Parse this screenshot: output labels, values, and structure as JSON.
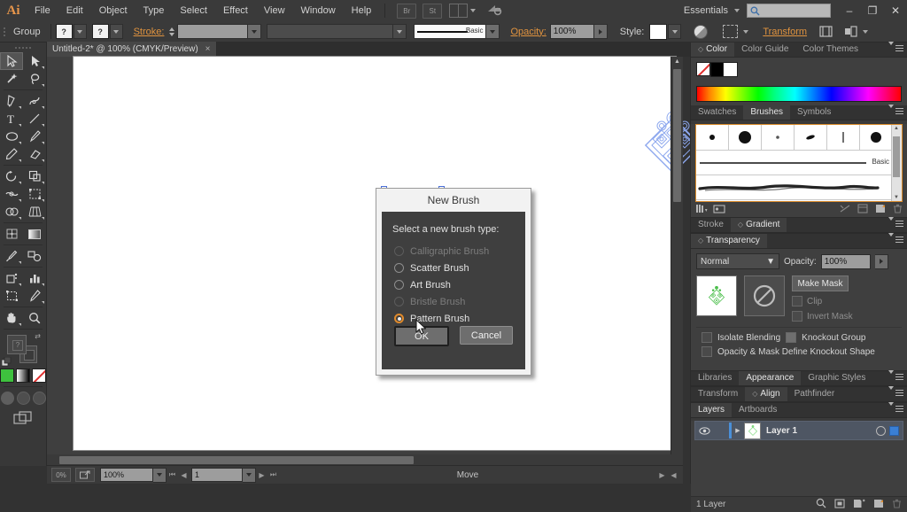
{
  "app": {
    "name": "Adobe Illustrator",
    "logo_text": "Ai"
  },
  "menubar": {
    "items": [
      "File",
      "Edit",
      "Object",
      "Type",
      "Select",
      "Effect",
      "View",
      "Window",
      "Help"
    ],
    "icons": [
      "br-bridge-icon",
      "stock-icon",
      "arrange-documents-icon",
      "sync-settings-icon"
    ],
    "workspace": "Essentials",
    "search_placeholder": "",
    "window_buttons": [
      "minimize-button",
      "restore-button",
      "close-button"
    ]
  },
  "controlbar": {
    "selection_label": "Group",
    "fill_swatch_label": "?",
    "stroke_swatch_label": "?",
    "stroke_label": "Stroke:",
    "stroke_weight": "",
    "stroke_profile": "",
    "brush_definition": "Basic",
    "opacity_label": "Opacity:",
    "opacity_value": "100%",
    "style_label": "Style:",
    "transform_label": "Transform",
    "icons": [
      "recolor-artwork-icon",
      "isolate-selected-icon",
      "align-icon",
      "distribute-icon"
    ]
  },
  "document": {
    "tab_title": "Untitled-2* @ 100% (CMYK/Preview)",
    "tab_close": "×"
  },
  "toolbar": {
    "tools": [
      {
        "name": "selection-tool",
        "selected": true
      },
      {
        "name": "direct-selection-tool",
        "selected": false
      },
      {
        "name": "magic-wand-tool",
        "selected": false
      },
      {
        "name": "lasso-tool",
        "selected": false
      },
      {
        "name": "pen-tool",
        "selected": false
      },
      {
        "name": "curvature-tool",
        "selected": false
      },
      {
        "name": "type-tool",
        "selected": false
      },
      {
        "name": "line-segment-tool",
        "selected": false
      },
      {
        "name": "ellipse-tool",
        "selected": false
      },
      {
        "name": "paintbrush-tool",
        "selected": false
      },
      {
        "name": "pencil-tool",
        "selected": false
      },
      {
        "name": "eraser-tool",
        "selected": false
      },
      {
        "name": "rotate-tool",
        "selected": false
      },
      {
        "name": "scale-tool",
        "selected": false
      },
      {
        "name": "width-tool",
        "selected": false
      },
      {
        "name": "free-transform-tool",
        "selected": false
      },
      {
        "name": "shape-builder-tool",
        "selected": false
      },
      {
        "name": "perspective-grid-tool",
        "selected": false
      },
      {
        "name": "mesh-tool",
        "selected": false
      },
      {
        "name": "gradient-tool",
        "selected": false
      },
      {
        "name": "eyedropper-tool",
        "selected": false
      },
      {
        "name": "blend-tool",
        "selected": false
      },
      {
        "name": "symbol-sprayer-tool",
        "selected": false
      },
      {
        "name": "column-graph-tool",
        "selected": false
      },
      {
        "name": "artboard-tool",
        "selected": false
      },
      {
        "name": "slice-tool",
        "selected": false
      },
      {
        "name": "hand-tool",
        "selected": false
      },
      {
        "name": "zoom-tool",
        "selected": false
      }
    ],
    "fill_label": "?",
    "color_modes": [
      "color-mode",
      "gradient-mode",
      "none-mode"
    ],
    "screen_modes": [
      "normal-screen-mode",
      "full-screen-with-menu",
      "full-screen"
    ],
    "accent_color": "#3ec13e"
  },
  "statusbar": {
    "zoom_value": "100%",
    "artboard_value": "1",
    "status_text": "Move"
  },
  "panels": {
    "color_group": {
      "tabs": [
        {
          "label": "Color",
          "active": true,
          "has_disclosure": true
        },
        {
          "label": "Color Guide",
          "active": false,
          "has_disclosure": false
        },
        {
          "label": "Color Themes",
          "active": false,
          "has_disclosure": false
        }
      ],
      "swatches": [
        "none-swatch",
        "black-swatch",
        "white-swatch"
      ]
    },
    "brushes_group": {
      "tabs": [
        {
          "label": "Swatches",
          "active": false,
          "has_disclosure": false
        },
        {
          "label": "Brushes",
          "active": true,
          "has_disclosure": false
        },
        {
          "label": "Symbols",
          "active": false,
          "has_disclosure": false
        }
      ],
      "calligraphic_brushes": 6,
      "basic_label": "Basic",
      "footer_icons": [
        "libraries-menu-icon",
        "brush-libraries-icon",
        "remove-brush-stroke-icon",
        "options-of-selected-object-icon",
        "new-brush-icon",
        "delete-brush-icon"
      ]
    },
    "stroke_gradient": {
      "tabs": [
        {
          "label": "Stroke",
          "active": false,
          "has_disclosure": false
        },
        {
          "label": "Gradient",
          "active": true,
          "has_disclosure": true
        }
      ]
    },
    "transparency": {
      "tabs": [
        {
          "label": "Transparency",
          "active": true,
          "has_disclosure": true
        }
      ],
      "blend_mode": "Normal",
      "opacity_label": "Opacity:",
      "opacity_value": "100%",
      "make_mask_label": "Make Mask",
      "clip_label": "Clip",
      "invert_mask_label": "Invert Mask",
      "isolate_blending_label": "Isolate Blending",
      "knockout_group_label": "Knockout Group",
      "knockout_shape_label": "Opacity & Mask Define Knockout Shape"
    },
    "appearance_group": {
      "tabs": [
        {
          "label": "Libraries",
          "active": false,
          "has_disclosure": false
        },
        {
          "label": "Appearance",
          "active": true,
          "has_disclosure": false
        },
        {
          "label": "Graphic Styles",
          "active": false,
          "has_disclosure": false
        }
      ]
    },
    "align_group": {
      "tabs": [
        {
          "label": "Transform",
          "active": false,
          "has_disclosure": false
        },
        {
          "label": "Align",
          "active": true,
          "has_disclosure": true
        },
        {
          "label": "Pathfinder",
          "active": false,
          "has_disclosure": false
        }
      ]
    },
    "layers_group": {
      "tabs": [
        {
          "label": "Layers",
          "active": true,
          "has_disclosure": false
        },
        {
          "label": "Artboards",
          "active": false,
          "has_disclosure": false
        }
      ],
      "rows": [
        {
          "name": "Layer 1",
          "visible": true,
          "locked": false,
          "selected": true
        }
      ],
      "footer_count": "1 Layer",
      "footer_icons": [
        "locate-object-icon",
        "make-sublayer-icon",
        "create-new-sublayer-icon",
        "create-new-layer-icon",
        "delete-selection-icon"
      ]
    }
  },
  "dialog": {
    "title": "New Brush",
    "prompt": "Select a new brush type:",
    "options": [
      {
        "label": "Calligraphic Brush",
        "enabled": false,
        "checked": false
      },
      {
        "label": "Scatter Brush",
        "enabled": true,
        "checked": false
      },
      {
        "label": "Art Brush",
        "enabled": true,
        "checked": false
      },
      {
        "label": "Bristle Brush",
        "enabled": false,
        "checked": false
      },
      {
        "label": "Pattern Brush",
        "enabled": true,
        "checked": true
      }
    ],
    "ok_label": "OK",
    "cancel_label": "Cancel",
    "accent_color": "#e08a2b"
  },
  "canvas": {
    "artwork": [
      {
        "name": "blue-ornament-pattern",
        "color": "#8da8ee"
      },
      {
        "name": "green-diamond-ornament",
        "color": "#4cbf4c",
        "selected": true
      }
    ]
  }
}
